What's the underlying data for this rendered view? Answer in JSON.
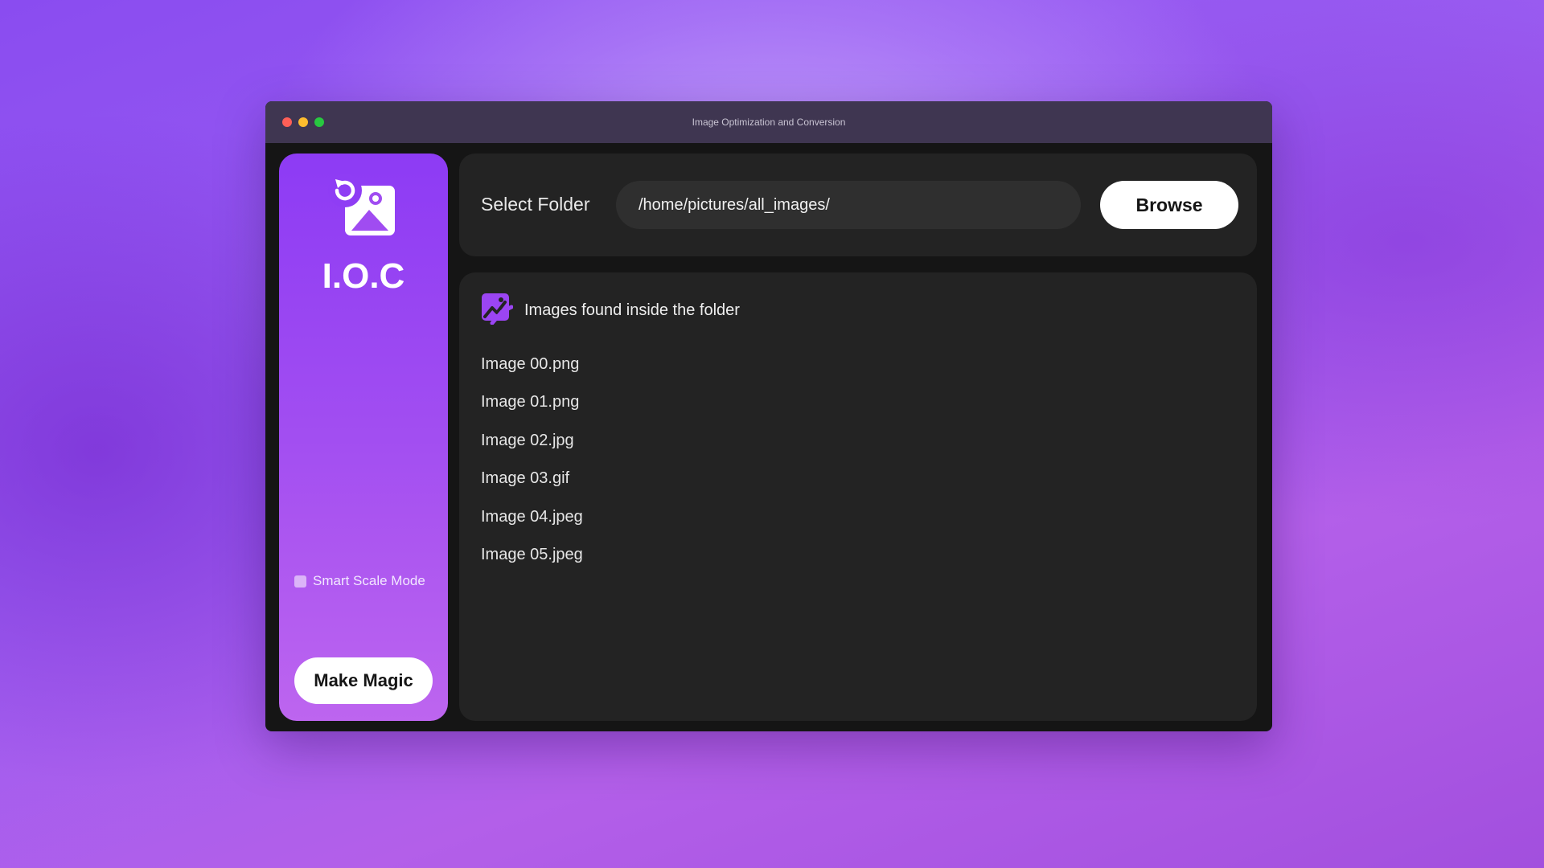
{
  "window": {
    "title": "Image Optimization and Conversion"
  },
  "sidebar": {
    "logo_icon": "image-convert-icon",
    "app_name": "I.O.C",
    "smart_scale": {
      "label": "Smart Scale Mode",
      "checked": false
    },
    "magic_button_label": "Make Magic"
  },
  "folder": {
    "label": "Select Folder",
    "path_value": "/home/pictures/all_images/",
    "browse_label": "Browse"
  },
  "images": {
    "header_icon": "images-icon",
    "title": "Images found inside the folder",
    "files": [
      "Image 00.png",
      "Image 01.png",
      "Image 02.jpg",
      "Image 03.gif",
      "Image 04.jpeg",
      "Image 05.jpeg"
    ]
  },
  "colors": {
    "accent": "#9b45f3",
    "window_bg": "#151515",
    "panel_bg": "#232323",
    "titlebar_bg": "#3f3651"
  }
}
